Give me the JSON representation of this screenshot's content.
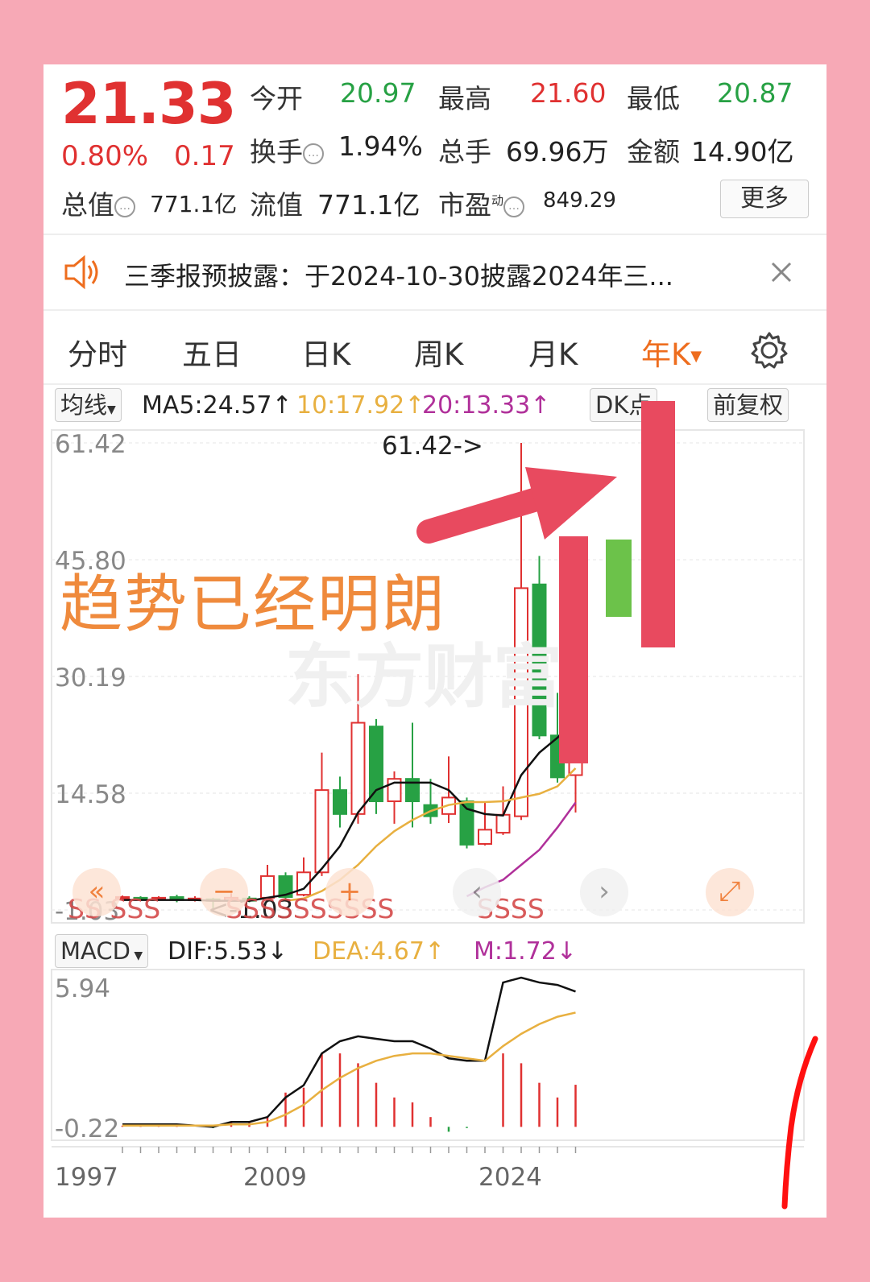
{
  "quote": {
    "price": "21.33",
    "change_pct": "0.80%",
    "change_abs": "0.17",
    "open_label": "今开",
    "open_value": "20.97",
    "high_label": "最高",
    "high_value": "21.60",
    "low_label": "最低",
    "low_value": "20.87",
    "turnover_label": "换手",
    "turnover_value": "1.94%",
    "volume_label": "总手",
    "volume_value": "69.96万",
    "amount_label": "金额",
    "amount_value": "14.90亿",
    "mktcap_label": "总值",
    "mktcap_value": "771.1亿",
    "float_label": "流值",
    "float_value": "771.1亿",
    "pe_label": "市盈",
    "pe_sup": "动",
    "pe_value": "849.29",
    "more_label": "更多"
  },
  "notice": {
    "text": "三季报预披露：于2024-10-30披露2024年三..."
  },
  "tabs": [
    {
      "label": "分时"
    },
    {
      "label": "五日"
    },
    {
      "label": "日K"
    },
    {
      "label": "周K"
    },
    {
      "label": "月K"
    },
    {
      "label": "年K"
    }
  ],
  "indicators": {
    "ma_select": "均线",
    "ma5": "MA5:24.57↑",
    "ma10": "10:17.92↑",
    "ma20": "20:13.33↑",
    "dk_label": "DK点",
    "adjust_label": "前复权",
    "macd_select": "MACD",
    "dif": "DIF:5.53↓",
    "dea": "DEA:4.67↑",
    "m": "M:1.72↓"
  },
  "overlay": {
    "title": "趋势已经明朗"
  },
  "colors": {
    "up": "#e03131",
    "down": "#27a144",
    "accent": "#ee6d1e",
    "ma5": "#111111",
    "ma10": "#e8b040",
    "ma20": "#b0309a",
    "annotation": "#e84a5f",
    "annotation_green": "#6cc24a"
  },
  "chart_data": {
    "type": "candlestick",
    "y_axis_ticks": [
      "61.42",
      "45.80",
      "30.19",
      "14.58",
      "-1.03"
    ],
    "max_marker": "61.42->",
    "min_marker": "<-1.03",
    "x_ticks": [
      "1997",
      "2009",
      "2024"
    ],
    "signal_marks": [
      "SS SSS",
      "SSSSSSSSSS",
      "SSSS"
    ],
    "candles": [
      {
        "o": 0.5,
        "c": 0.7,
        "h": 0.9,
        "l": 0.3,
        "up": true
      },
      {
        "o": 0.6,
        "c": 0.4,
        "h": 0.8,
        "l": 0.2,
        "up": false
      },
      {
        "o": 0.4,
        "c": 0.6,
        "h": 0.8,
        "l": 0.2,
        "up": true
      },
      {
        "o": 0.7,
        "c": 0.3,
        "h": 1.0,
        "l": 0.0,
        "up": false
      },
      {
        "o": 0.3,
        "c": 0.5,
        "h": 0.8,
        "l": 0.1,
        "up": true
      },
      {
        "o": 0.4,
        "c": 0.2,
        "h": 0.6,
        "l": -1.03,
        "up": false
      },
      {
        "o": 0.3,
        "c": 0.6,
        "h": 1.2,
        "l": 0.1,
        "up": true
      },
      {
        "o": 0.5,
        "c": 0.2,
        "h": 0.8,
        "l": 0.0,
        "up": false
      },
      {
        "o": 0.6,
        "c": 3.5,
        "h": 5.0,
        "l": 0.5,
        "up": true
      },
      {
        "o": 3.5,
        "c": 0.7,
        "h": 4.0,
        "l": 0.4,
        "up": false
      },
      {
        "o": 1.0,
        "c": 4.0,
        "h": 6.0,
        "l": 0.8,
        "up": true
      },
      {
        "o": 4.0,
        "c": 15.0,
        "h": 20.0,
        "l": 3.5,
        "up": true
      },
      {
        "o": 15.0,
        "c": 11.8,
        "h": 16.8,
        "l": 10.0,
        "up": false
      },
      {
        "o": 11.8,
        "c": 24.0,
        "h": 30.5,
        "l": 10.5,
        "up": true
      },
      {
        "o": 23.5,
        "c": 13.5,
        "h": 24.5,
        "l": 11.8,
        "up": false
      },
      {
        "o": 13.5,
        "c": 16.5,
        "h": 17.5,
        "l": 10.5,
        "up": true
      },
      {
        "o": 16.5,
        "c": 13.5,
        "h": 24.0,
        "l": 10.0,
        "up": false
      },
      {
        "o": 13.0,
        "c": 11.5,
        "h": 16.5,
        "l": 10.5,
        "up": false
      },
      {
        "o": 11.8,
        "c": 14.0,
        "h": 19.5,
        "l": 10.6,
        "up": true
      },
      {
        "o": 13.5,
        "c": 7.7,
        "h": 14.0,
        "l": 7.2,
        "up": false
      },
      {
        "o": 7.8,
        "c": 9.7,
        "h": 13.5,
        "l": 7.6,
        "up": true
      },
      {
        "o": 9.3,
        "c": 11.7,
        "h": 15.5,
        "l": 9.0,
        "up": true
      },
      {
        "o": 11.5,
        "c": 42.0,
        "h": 61.42,
        "l": 11.0,
        "up": true
      },
      {
        "o": 42.5,
        "c": 22.3,
        "h": 46.3,
        "l": 21.8,
        "up": false
      },
      {
        "o": 22.3,
        "c": 16.7,
        "h": 28.0,
        "l": 16.0,
        "up": false
      },
      {
        "o": 17.0,
        "c": 19.0,
        "h": 21.6,
        "l": 12.0,
        "up": true
      }
    ],
    "ma5": [
      0.3,
      0.3,
      0.3,
      0.3,
      0.3,
      0.2,
      0.2,
      0.2,
      0.6,
      1.0,
      1.8,
      4.5,
      7.5,
      12.0,
      15.0,
      16.0,
      16.0,
      16.0,
      15.0,
      12.5,
      11.8,
      11.6,
      17.0,
      20.0,
      22.0,
      24.57
    ],
    "ma10": [
      null,
      null,
      null,
      null,
      null,
      null,
      null,
      null,
      null,
      0.2,
      0.5,
      1.5,
      3.0,
      5.0,
      7.5,
      9.5,
      11.0,
      12.2,
      13.0,
      13.4,
      13.4,
      13.5,
      14.0,
      14.5,
      15.5,
      17.92
    ],
    "ma20": [
      null,
      null,
      null,
      null,
      null,
      null,
      null,
      null,
      null,
      null,
      null,
      null,
      null,
      null,
      null,
      null,
      null,
      null,
      null,
      0.8,
      2.0,
      3.0,
      5.0,
      7.0,
      10.0,
      13.33
    ],
    "macd_y_ticks": [
      "5.94",
      "-0.22"
    ],
    "dif": [
      0.1,
      0.1,
      0.1,
      0.1,
      0.05,
      0.0,
      0.2,
      0.2,
      0.4,
      1.2,
      1.7,
      3.0,
      3.5,
      3.7,
      3.6,
      3.5,
      3.5,
      3.2,
      2.8,
      2.7,
      2.7,
      5.9,
      6.1,
      5.9,
      5.8,
      5.53
    ],
    "dea": [
      0.05,
      0.05,
      0.05,
      0.05,
      0.05,
      0.05,
      0.1,
      0.1,
      0.2,
      0.5,
      0.9,
      1.5,
      2.0,
      2.4,
      2.7,
      2.9,
      3.0,
      3.0,
      2.9,
      2.8,
      2.7,
      3.3,
      3.8,
      4.2,
      4.5,
      4.67
    ],
    "m": [
      0.05,
      0.05,
      0.05,
      0.05,
      0.0,
      -0.05,
      0.2,
      0.2,
      0.4,
      1.4,
      1.6,
      3.0,
      3.0,
      2.6,
      1.8,
      1.2,
      1.0,
      0.4,
      -0.2,
      -0.05,
      0.0,
      3.0,
      2.6,
      1.8,
      1.2,
      1.72
    ]
  }
}
